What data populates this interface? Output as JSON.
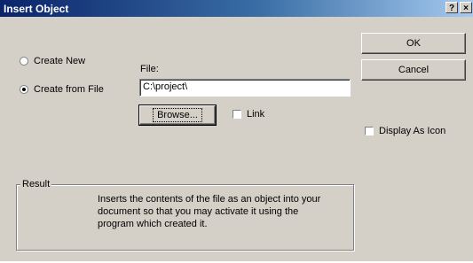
{
  "window": {
    "title": "Insert Object"
  },
  "titlebar_buttons": {
    "help": "?",
    "close": "×"
  },
  "options": {
    "create_new": "Create New",
    "create_from_file": "Create from File"
  },
  "file": {
    "label": "File:",
    "value": "C:\\project\\"
  },
  "buttons": {
    "ok": "OK",
    "cancel": "Cancel",
    "browse": "Browse..."
  },
  "checks": {
    "link": "Link",
    "display_as_icon": "Display As Icon"
  },
  "result": {
    "legend": "Result",
    "lines": [
      "Inserts the contents of the file as an object into your",
      "document so that you may activate it using the",
      "program which created it."
    ]
  },
  "icons": {
    "help": "help-icon",
    "close": "close-icon"
  },
  "colors": {
    "titlebar_start": "#0a246a",
    "titlebar_end": "#a6caf0",
    "face": "#d4d0c8"
  }
}
